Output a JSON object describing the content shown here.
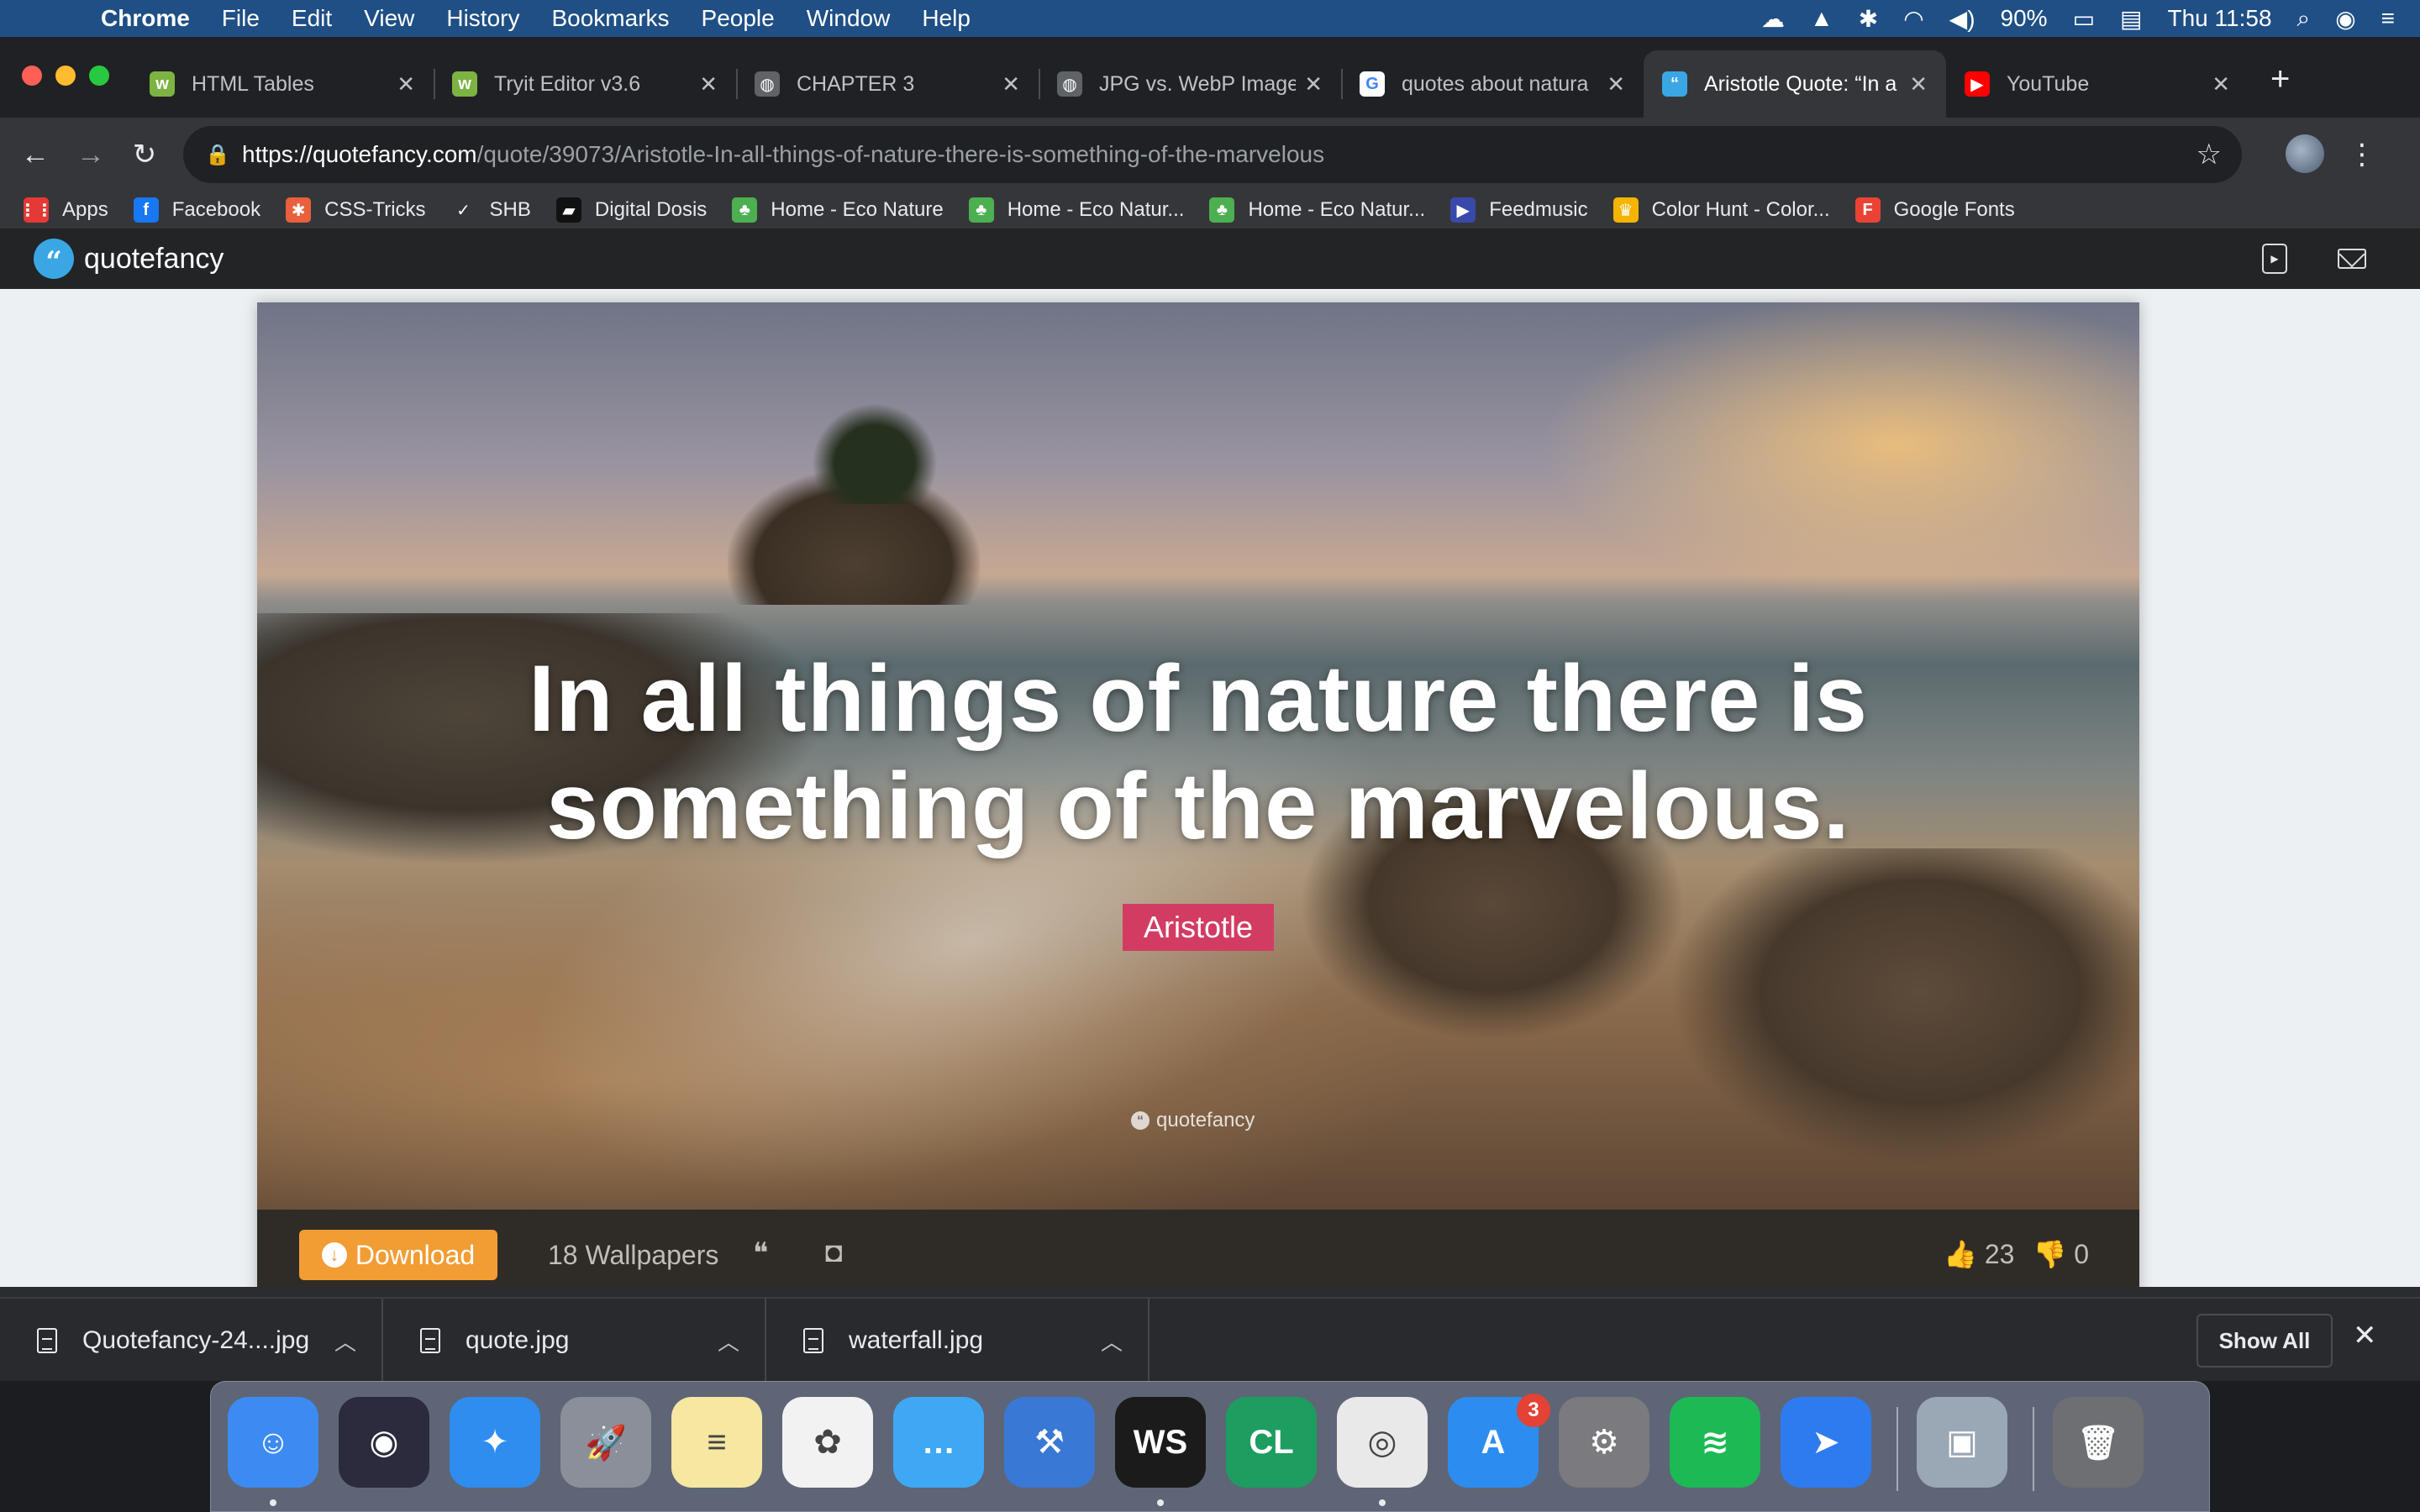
{
  "menubar": {
    "app": "Chrome",
    "items": [
      "File",
      "Edit",
      "View",
      "History",
      "Bookmarks",
      "People",
      "Window",
      "Help"
    ],
    "battery": "90%",
    "clock": "Thu 11:58"
  },
  "tabs": [
    {
      "title": "HTML Tables",
      "favicon_color": "#7cb342",
      "favicon_glyph": "w"
    },
    {
      "title": "Tryit Editor v3.6",
      "favicon_color": "#7cb342",
      "favicon_glyph": "w"
    },
    {
      "title": "CHAPTER 3",
      "favicon_color": "#5f6368",
      "favicon_glyph": "◍"
    },
    {
      "title": "JPG vs. WebP Image",
      "favicon_color": "#5f6368",
      "favicon_glyph": "◍"
    },
    {
      "title": "quotes about natura",
      "favicon_color": "#ffffff",
      "favicon_glyph": "G"
    },
    {
      "title": "Aristotle Quote: “In a",
      "favicon_color": "#3aa7e4",
      "favicon_glyph": "“",
      "active": true
    },
    {
      "title": "YouTube",
      "favicon_color": "#ff0000",
      "favicon_glyph": "▶"
    }
  ],
  "toolbar": {
    "url_host": "https://quotefancy.com",
    "url_path": "/quote/39073/Aristotle-In-all-things-of-nature-there-is-something-of-the-marvelous"
  },
  "bookmarks": [
    {
      "label": "Apps",
      "icon": "apps-grid-icon",
      "color": "#e53935",
      "glyph": "⋮⋮"
    },
    {
      "label": "Facebook",
      "icon": "facebook-icon",
      "color": "#1877f2",
      "glyph": "f"
    },
    {
      "label": "CSS-Tricks",
      "icon": "css-tricks-icon",
      "color": "#e8603c",
      "glyph": "✱"
    },
    {
      "label": "SHB",
      "icon": "check-icon",
      "color": "#35363a",
      "glyph": "✓"
    },
    {
      "label": "Digital Dosis",
      "icon": "digital-dosis-icon",
      "color": "#111111",
      "glyph": "▰"
    },
    {
      "label": "Home - Eco Nature",
      "icon": "eco-nature-icon",
      "color": "#4caf50",
      "glyph": "♣"
    },
    {
      "label": "Home - Eco Natur...",
      "icon": "eco-nature-icon",
      "color": "#4caf50",
      "glyph": "♣"
    },
    {
      "label": "Home - Eco Natur...",
      "icon": "eco-nature-icon",
      "color": "#4caf50",
      "glyph": "♣"
    },
    {
      "label": "Feedmusic",
      "icon": "feedmusic-icon",
      "color": "#3949ab",
      "glyph": "▶"
    },
    {
      "label": "Color Hunt - Color...",
      "icon": "color-hunt-icon",
      "color": "#f4b400",
      "glyph": "♛"
    },
    {
      "label": "Google Fonts",
      "icon": "google-fonts-icon",
      "color": "#ea4335",
      "glyph": "F"
    }
  ],
  "site": {
    "logo": "quotefancy",
    "quote": "In all things of nature there is something of the marvelous.",
    "author": "Aristotle",
    "watermark": "quotefancy",
    "download_label": "Download",
    "wallpapers_label": "18 Wallpapers",
    "likes": "23",
    "dislikes": "0"
  },
  "downloads": {
    "items": [
      {
        "name": "Quotefancy-24....jpg"
      },
      {
        "name": "quote.jpg"
      },
      {
        "name": "waterfall.jpg"
      }
    ],
    "show_all": "Show All"
  },
  "dock": [
    {
      "name": "Finder",
      "color": "#3d8bf2",
      "glyph": "☺"
    },
    {
      "name": "Siri",
      "color": "#2b2b3d",
      "glyph": "◉"
    },
    {
      "name": "Safari",
      "color": "#2f8df0",
      "glyph": "✦"
    },
    {
      "name": "Launchpad",
      "color": "#8a8f99",
      "glyph": "🚀"
    },
    {
      "name": "Notes",
      "color": "#f6e7a1",
      "glyph": "≡"
    },
    {
      "name": "Photos",
      "color": "#f2f2f2",
      "glyph": "✿"
    },
    {
      "name": "Messages",
      "color": "#3fa8f5",
      "glyph": "…"
    },
    {
      "name": "Xcode",
      "color": "#3a78d6",
      "glyph": "⚒"
    },
    {
      "name": "WebStorm",
      "color": "#1b1b1b",
      "glyph": "WS"
    },
    {
      "name": "CLion",
      "color": "#1d9d5f",
      "glyph": "CL"
    },
    {
      "name": "Chrome",
      "color": "#e9e9e9",
      "glyph": "◎"
    },
    {
      "name": "App Store",
      "color": "#2d8cf0",
      "glyph": "A",
      "badge": "3"
    },
    {
      "name": "System Preferences",
      "color": "#7a7a7f",
      "glyph": "⚙"
    },
    {
      "name": "Spotify",
      "color": "#1db954",
      "glyph": "≋"
    },
    {
      "name": "Navigator",
      "color": "#2e7bf0",
      "glyph": "➤"
    },
    {
      "name": "Preview",
      "color": "#9aa7b5",
      "glyph": "▣"
    },
    {
      "name": "Trash",
      "color": "#6d6f73",
      "glyph": "🗑"
    }
  ]
}
